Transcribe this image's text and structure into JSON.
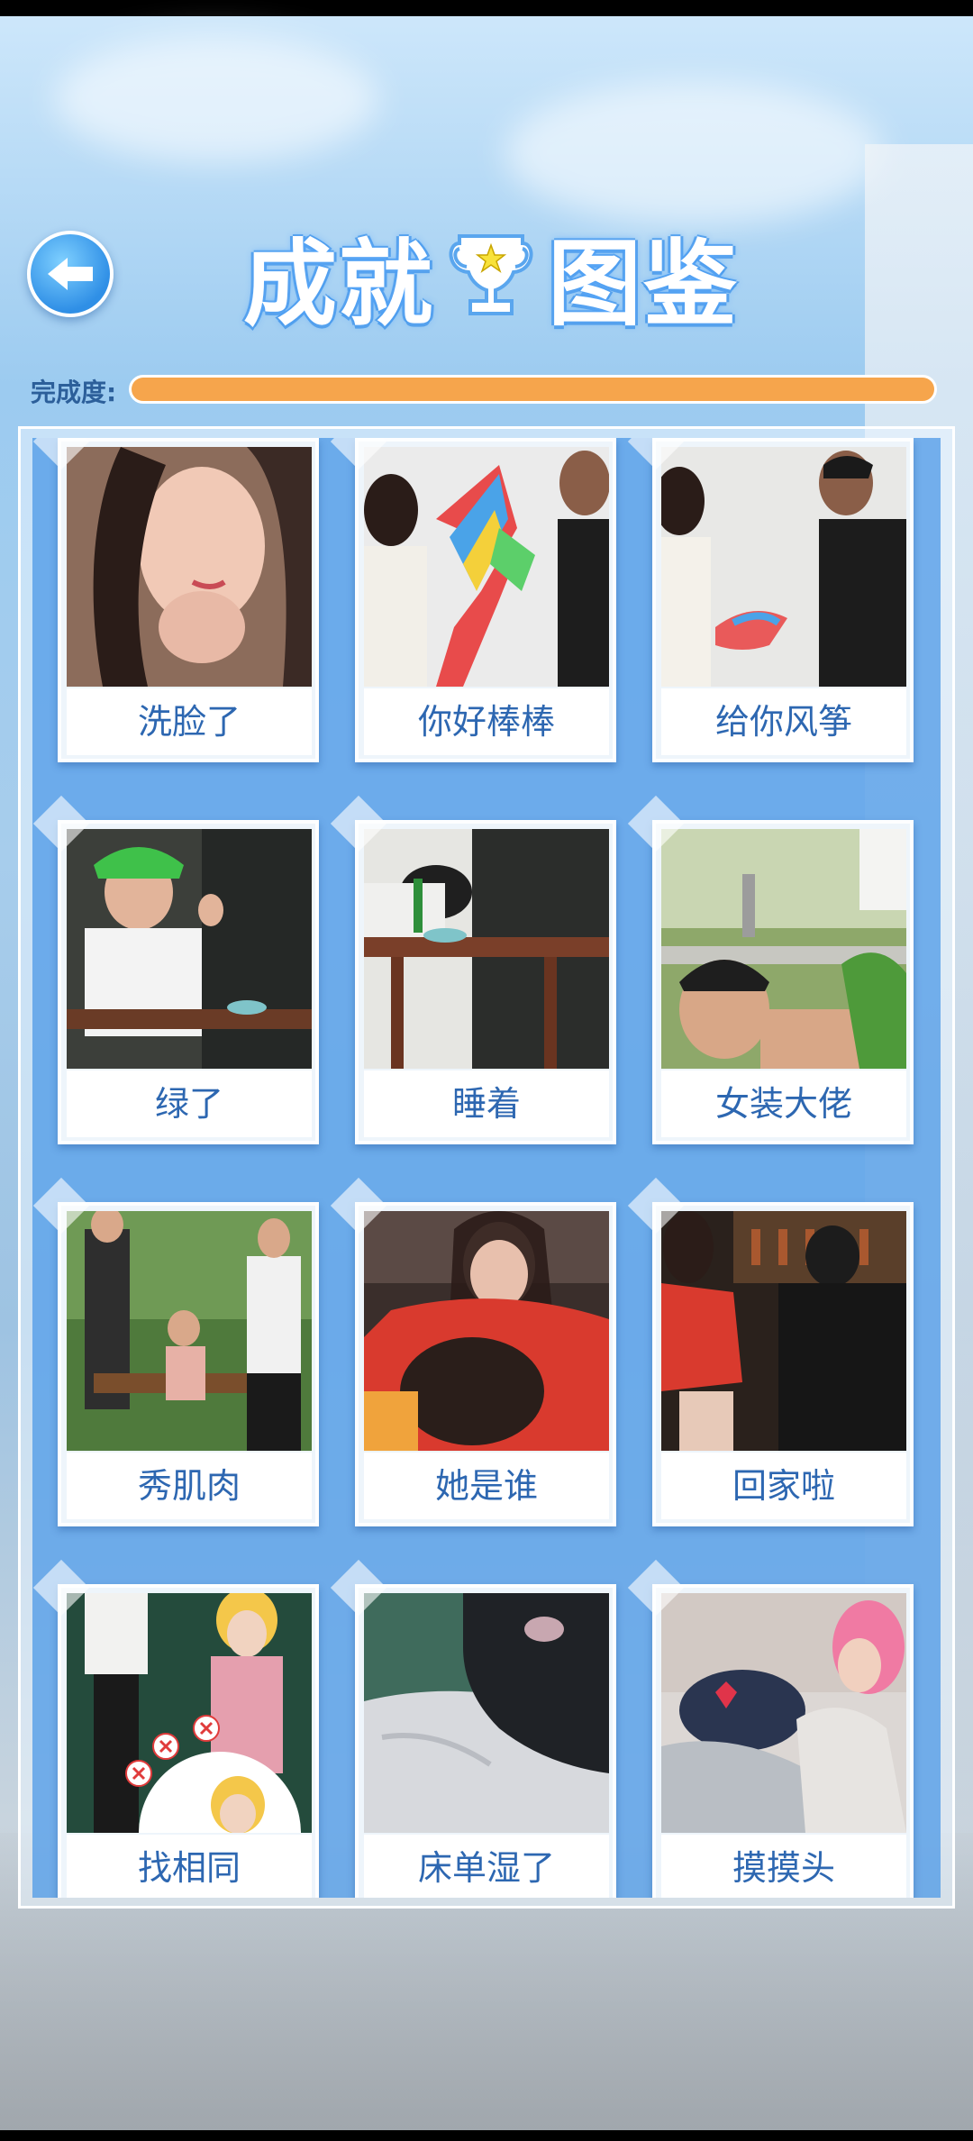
{
  "header": {
    "title_left": "成就",
    "title_right": "图鉴",
    "back_icon": "back-arrow-icon",
    "trophy_icon": "trophy-icon"
  },
  "progress": {
    "label": "完成度:",
    "value": 1.0
  },
  "achievements": [
    {
      "label": "洗脸了",
      "image": "woman-face-eyes-closed"
    },
    {
      "label": "你好棒棒",
      "image": "couple-rainbow-kite"
    },
    {
      "label": "给你风筝",
      "image": "man-giving-kite"
    },
    {
      "label": "绿了",
      "image": "man-green-hat-cafe"
    },
    {
      "label": "睡着",
      "image": "man-asleep-table"
    },
    {
      "label": "女装大佬",
      "image": "man-in-park"
    },
    {
      "label": "秀肌肉",
      "image": "men-flexing-bench"
    },
    {
      "label": "她是谁",
      "image": "woman-red-sweater"
    },
    {
      "label": "回家啦",
      "image": "couple-at-bar"
    },
    {
      "label": "找相同",
      "image": "spot-the-difference"
    },
    {
      "label": "床单湿了",
      "image": "wet-bedsheet"
    },
    {
      "label": "摸摸头",
      "image": "pink-hair-pat-head"
    }
  ]
}
